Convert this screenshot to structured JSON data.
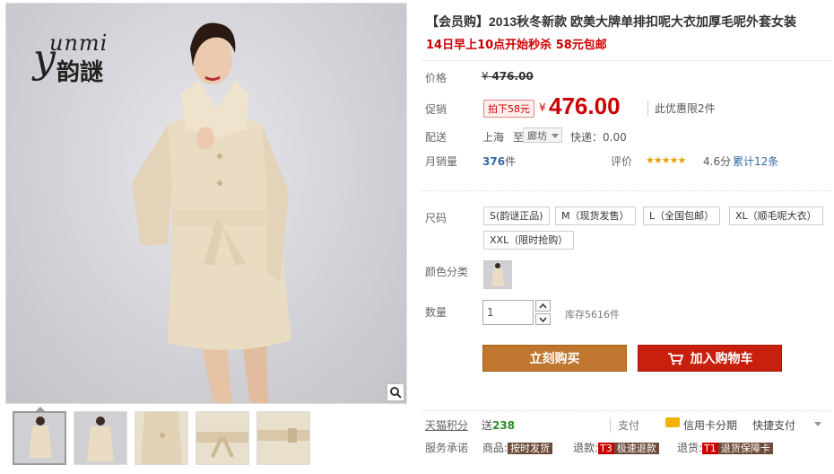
{
  "product": {
    "title": "【会员购】2013秋冬新款 欧美大牌单排扣呢大衣加厚毛呢外套女装",
    "subtitle": "14日早上10点开始秒杀 58元包邮",
    "brand": {
      "latin": "unmi",
      "initial": "y",
      "chinese": "韵謎"
    }
  },
  "pricing": {
    "price_label": "价格",
    "orig_currency": "¥",
    "orig_price": "476.00",
    "promo_label": "促销",
    "promo_tag": "拍下58元",
    "promo_currency": "¥",
    "promo_price": "476.00",
    "promo_limit": "此优惠限2件"
  },
  "shipping": {
    "label": "配送",
    "from": "上海",
    "to_word": "至",
    "to": "廊坊",
    "express": "快递：0.00"
  },
  "sales": {
    "label": "月销量",
    "count": "376",
    "unit": "件",
    "rating_label": "评价",
    "stars": "★★★★★",
    "score": "4.6分",
    "reviews": "累计12条"
  },
  "options": {
    "size_label": "尺码",
    "sizes": [
      "S(韵谜正品)",
      "M（现货发售）",
      "L（全国包邮）",
      "XL（顺毛呢大衣）",
      "XXL（限时抢购）"
    ],
    "color_label": "颜色分类",
    "qty_label": "数量",
    "qty_value": "1",
    "stock": "库存5616件"
  },
  "actions": {
    "buy_now": "立刻购买",
    "add_cart": "加入购物车"
  },
  "footer": {
    "points_label": "天猫积分",
    "points_prefix": "送",
    "points_value": "238",
    "pay_label": "支付",
    "credit_text": "信用卡分期",
    "quick_pay": "快捷支付",
    "service_label": "服务承诺",
    "svc1_prefix": "商品:",
    "svc1_tag": "按时发货",
    "svc2_prefix": "退款:",
    "svc2_badge": "T3",
    "svc2_tag": "极速退款",
    "svc3_prefix": "退货:",
    "svc3_badge": "T1",
    "svc3_tag": "退货保障卡"
  },
  "colors": {
    "price_red": "#cc0000",
    "buy_brown": "#c0762e",
    "cart_red": "#c7200e",
    "link_blue": "#2f6aa4"
  },
  "icons": [
    "zoom-icon",
    "cart-icon",
    "credit-card-icon",
    "chevron-up-icon",
    "chevron-down-icon"
  ]
}
